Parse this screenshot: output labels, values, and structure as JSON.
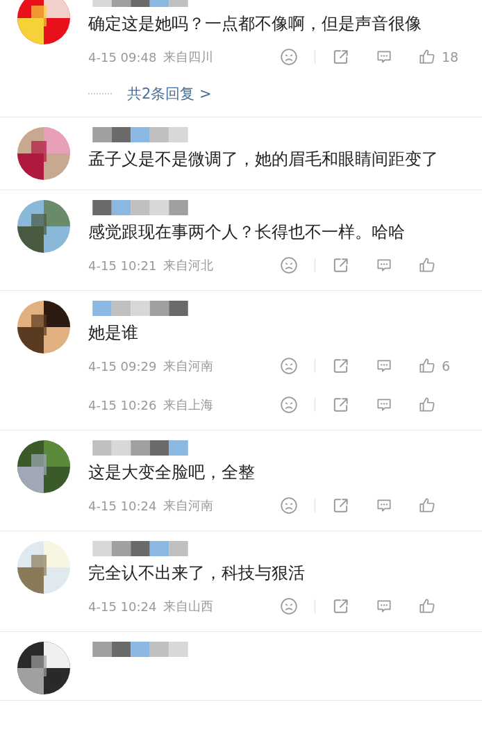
{
  "comments": [
    {
      "avatar": {
        "kind": "picture"
      },
      "text": "确定这是她吗？一点都不像啊，但是声音很像",
      "meta": [
        {
          "time": "4-15 09:48",
          "location": "来自四川",
          "likes": "18"
        }
      ],
      "replies": "共2条回复 >"
    },
    {
      "avatar": {
        "kind": "picture"
      },
      "text": "孟子义是不是微调了，她的眉毛和眼睛间距变了"
    },
    {
      "avatar": {
        "kind": "picture"
      },
      "text": "感觉跟现在事两个人？长得也不一样。哈哈",
      "meta": [
        {
          "time": "4-15 10:21",
          "location": "来自河北"
        }
      ]
    },
    {
      "avatar": {
        "kind": "picture"
      },
      "text": "她是谁",
      "meta": [
        {
          "time": "4-15 09:29",
          "location": "来自河南",
          "likes": "6"
        },
        {
          "time": "4-15 10:26",
          "location": "来自上海"
        }
      ]
    },
    {
      "avatar": {
        "kind": "picture"
      },
      "text": "这是大变全脸吧，全整",
      "meta": [
        {
          "time": "4-15 10:24",
          "location": "来自河南"
        }
      ]
    },
    {
      "avatar": {
        "kind": "picture"
      },
      "text": "完全认不出来了，科技与狠活",
      "meta": [
        {
          "time": "4-15 10:24",
          "location": "来自山西"
        }
      ]
    },
    {
      "avatar": {
        "kind": "picture"
      }
    }
  ]
}
